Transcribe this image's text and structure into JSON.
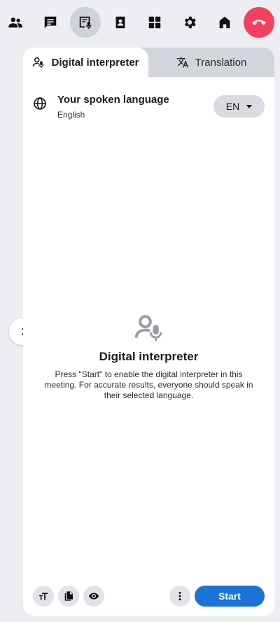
{
  "toolbar": {
    "items": [
      {
        "icon": "people-icon",
        "active": false
      },
      {
        "icon": "chat-icon",
        "active": false
      },
      {
        "icon": "interpreter-icon",
        "active": true
      },
      {
        "icon": "contacts-icon",
        "active": false
      },
      {
        "icon": "apps-icon",
        "active": false
      },
      {
        "icon": "settings-icon",
        "active": false
      },
      {
        "icon": "home-icon",
        "active": false
      },
      {
        "icon": "end-call-icon",
        "active": false
      }
    ],
    "end_call_color": "#f43f5e"
  },
  "tabs": [
    {
      "label": "Digital interpreter",
      "icon": "interpreter-icon",
      "selected": true
    },
    {
      "label": "Translation",
      "icon": "translate-icon",
      "selected": false
    }
  ],
  "language": {
    "title": "Your spoken language",
    "subtitle": "English",
    "selected": "EN",
    "icon": "globe-icon"
  },
  "empty_state": {
    "title": "Digital interpreter",
    "description": "Press \"Start\" to enable the digital interpreter in this meeting. For accurate results, everyone should speak in their selected language."
  },
  "bottom_bar": {
    "buttons": [
      "text-size-icon",
      "copy-icon",
      "eye-icon",
      "more-icon"
    ],
    "start_label": "Start",
    "start_color": "#1a73d9"
  },
  "expander_icon": "chevron-right-icon"
}
